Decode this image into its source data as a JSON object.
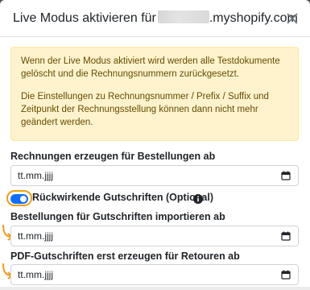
{
  "modal": {
    "title_prefix": "Live Modus aktivieren für",
    "title_suffix": ".myshopify.com",
    "close_icon": "close-icon"
  },
  "alert": {
    "paragraph1": "Wenn der Live Modus aktiviert wird werden alle Testdokumente gelöscht und die Rechnungsnummern zurückgesetzt.",
    "paragraph2": "Die Einstellungen zu Rechnungsnummer / Prefix / Suffix und Zeitpunkt der Rechnungsstellung können dann nicht mehr geändert werden.",
    "bg_color": "#fff3cd",
    "text_color": "#664d03"
  },
  "fields": {
    "invoices_label": "Rechnungen erzeugen für Bestellungen ab",
    "invoices_value": "tt.mm.jjjj",
    "credit_toggle_label": "Rückwirkende Gutschriften (Optional)",
    "credit_toggle_on": true,
    "import_label": "Bestellungen für Gutschriften importieren ab",
    "import_value": "tt.mm.jjjj",
    "pdf_label": "PDF-Gutschriften erst erzeugen für Retouren ab",
    "pdf_value": "tt.mm.jjjj"
  },
  "colors": {
    "accent": "#0d6efd",
    "highlight": "#f39c12"
  }
}
